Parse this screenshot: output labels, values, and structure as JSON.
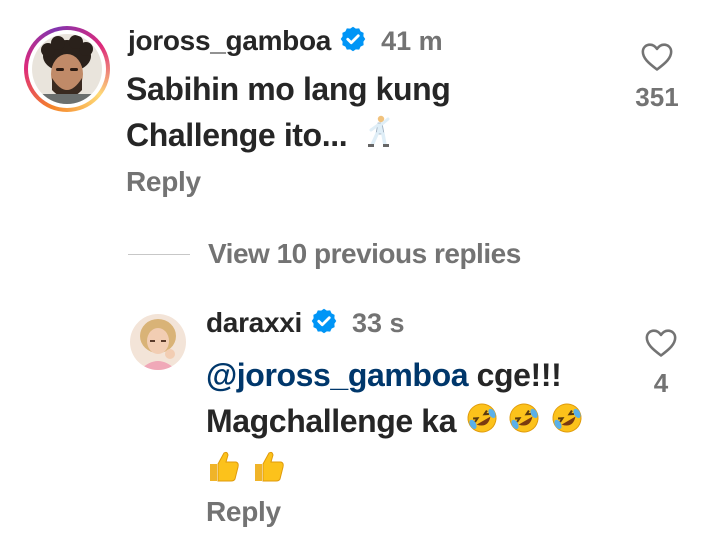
{
  "comments": [
    {
      "username": "joross_gamboa",
      "time": "41 m",
      "text_line1": "Sabihin mo lang kung",
      "text_line2": "Challenge ito...",
      "text_emoji": "dancing-man-emoji",
      "reply_label": "Reply",
      "like_count": "351"
    },
    {
      "username": "daraxxi",
      "time": "33 s",
      "mention": "@joross_gamboa",
      "text_after_mention": " cge!!!",
      "text_line2": "Magchallenge ka",
      "text_emojis": [
        "rolling-on-floor-laughing-emoji",
        "rolling-on-floor-laughing-emoji",
        "rolling-on-floor-laughing-emoji",
        "thumbs-up-emoji",
        "thumbs-up-emoji"
      ],
      "reply_label": "Reply",
      "like_count": "4"
    }
  ],
  "view_replies": {
    "label": "View 10 previous replies"
  },
  "colors": {
    "text": "#262626",
    "secondary": "#737373",
    "mention": "#00376b",
    "verified": "#0095f6"
  }
}
